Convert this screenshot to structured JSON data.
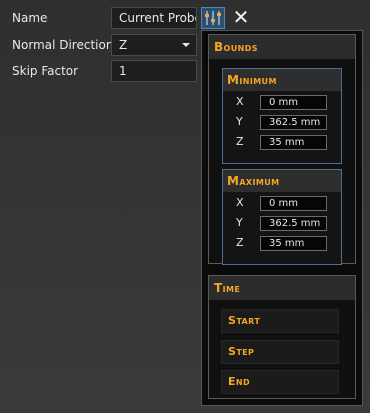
{
  "properties": {
    "name_label": "Name",
    "name_value": "Current Probe",
    "normal_direction_label": "Normal Direction",
    "normal_direction_value": "Z",
    "skip_factor_label": "Skip Factor",
    "skip_factor_value": "1"
  },
  "toolbar": {
    "settings_icon": "sliders-icon",
    "close_label": "✕"
  },
  "bounds": {
    "title": "Bounds",
    "minimum": {
      "title": "Minimum",
      "x_label": "X",
      "x_value": "0 mm",
      "y_label": "Y",
      "y_value": "362.5 mm",
      "z_label": "Z",
      "z_value": "35 mm"
    },
    "maximum": {
      "title": "Maximum",
      "x_label": "X",
      "x_value": "0 mm",
      "y_label": "Y",
      "y_value": "362.5 mm",
      "z_label": "Z",
      "z_value": "35 mm"
    }
  },
  "time": {
    "title": "Time",
    "start_label": "Start",
    "step_label": "Step",
    "end_label": "End"
  },
  "colors": {
    "accent": "#f5a623",
    "panel_bg": "#0b0b0b",
    "subgroup_border": "#4e6f8e",
    "settings_button_bg": "#2b4f73"
  }
}
